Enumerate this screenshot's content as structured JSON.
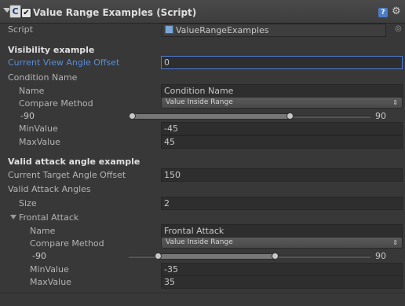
{
  "component": {
    "title": "Value Range Examples (Script)",
    "enabled_check": "✔",
    "icon_letter": "C",
    "help_icon_glyph": "?",
    "gear_icon_glyph": "⚙"
  },
  "script_row": {
    "label": "Script",
    "value": "ValueRangeExamples",
    "target_icon_glyph": "◎"
  },
  "visibility": {
    "section_title": "Visibility example",
    "view_angle_label": "Current View Angle Offset",
    "view_angle_value": "0",
    "condition_label": "Condition Name",
    "name_label": "Name",
    "name_value": "Condition Name",
    "compare_label": "Compare Method",
    "compare_value": "Value Inside Range",
    "slider_min": "-90",
    "slider_max": "90",
    "range_low_fraction": 0,
    "range_high_fraction": 0.75,
    "min_label": "MinValue",
    "min_value": "-45",
    "max_label": "MaxValue",
    "max_value": "45"
  },
  "valid_attack": {
    "section_title": "Valid attack angle example",
    "target_angle_label": "Current Target Angle Offset",
    "target_angle_value": "150",
    "angles_label": "Valid Attack Angles",
    "size_label": "Size",
    "size_value": "2",
    "frontal_label": "Frontal Attack",
    "name_label": "Name",
    "name_value": "Frontal Attack",
    "compare_label": "Compare Method",
    "compare_value": "Value Inside Range",
    "slider_min": "-90",
    "slider_max": "90",
    "min_label": "MinValue",
    "min_value": "-35",
    "max_label": "MaxValue",
    "max_value": "35"
  }
}
